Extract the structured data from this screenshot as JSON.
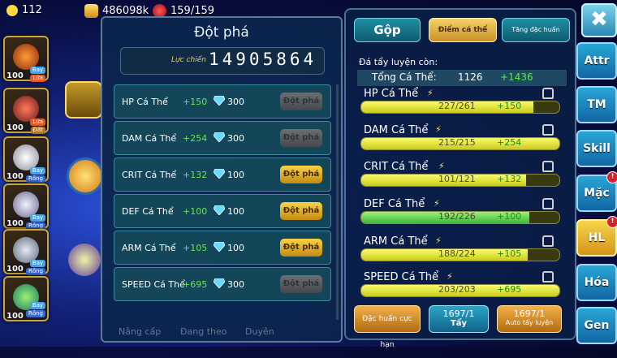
{
  "topbar": {
    "level": "112",
    "gold": "486098k",
    "energy": "159/159"
  },
  "heroes": [
    {
      "level": "100",
      "tags": [
        "Bay",
        "Lửa"
      ]
    },
    {
      "level": "100",
      "tags": [
        "Lửa",
        "Đất"
      ]
    },
    {
      "level": "100",
      "tags": [
        "Bay",
        "Rồng"
      ]
    },
    {
      "level": "100",
      "tags": [
        "Bay",
        "Rồng"
      ]
    },
    {
      "level": "100",
      "tags": [
        "Bay",
        "Rồng"
      ]
    },
    {
      "level": "100",
      "tags": [
        "Bay",
        "Rồng"
      ]
    }
  ],
  "breakthrough": {
    "title": "Đột phá",
    "power_label": "Lực chiến",
    "power_value": "14905864",
    "rows": [
      {
        "name": "HP Cá Thể",
        "bonus": "+150",
        "cost": "300",
        "button": "Đột phá",
        "enabled": false
      },
      {
        "name": "DAM Cá Thể",
        "bonus": "+254",
        "cost": "300",
        "button": "Đột phá",
        "enabled": false
      },
      {
        "name": "CRIT Cá Thể",
        "bonus": "+132",
        "cost": "100",
        "button": "Đột phá",
        "enabled": true
      },
      {
        "name": "DEF Cá Thể",
        "bonus": "+100",
        "cost": "100",
        "button": "Đột phá",
        "enabled": true
      },
      {
        "name": "ARM Cá Thể",
        "bonus": "+105",
        "cost": "100",
        "button": "Đột phá",
        "enabled": true
      },
      {
        "name": "SPEED Cá Thể",
        "bonus": "+695",
        "cost": "300",
        "button": "Đột phá",
        "enabled": false
      }
    ],
    "bottom_nav": [
      "Nâng cấp",
      "Đang theo",
      "Duyên"
    ]
  },
  "training": {
    "tabs": {
      "merge": "Gộp",
      "points": "Điểm cá thể",
      "special": "Tăng đặc huấn"
    },
    "subtitle": "Đá tẩy luyện còn:",
    "total_label": "Tổng Cá Thể:",
    "total_value": "1126",
    "total_bonus": "+1436",
    "stats": [
      {
        "name": "HP Cá Thể",
        "value": "227/261",
        "bonus": "+150",
        "fill": 0.87,
        "color": "yellow"
      },
      {
        "name": "DAM Cá Thể",
        "value": "215/215",
        "bonus": "+254",
        "fill": 1.0,
        "color": "yellow"
      },
      {
        "name": "CRIT Cá Thể",
        "value": "101/121",
        "bonus": "+132",
        "fill": 0.83,
        "color": "yellow"
      },
      {
        "name": "DEF Cá Thể",
        "value": "192/226",
        "bonus": "+100",
        "fill": 0.85,
        "color": "green"
      },
      {
        "name": "ARM Cá Thể",
        "value": "188/224",
        "bonus": "+105",
        "fill": 0.84,
        "color": "yellow"
      },
      {
        "name": "SPEED Cá Thể",
        "value": "203/203",
        "bonus": "+695",
        "fill": 1.0,
        "color": "yellow"
      }
    ],
    "buttons": {
      "special_training": "Đặc huấn cực hạn",
      "wash_count": "1697/1",
      "wash_label": "Tẩy",
      "auto_count": "1697/1",
      "auto_label": "Auto tẩy luyện"
    }
  },
  "side_tabs": [
    {
      "label": "Attr",
      "badge": false
    },
    {
      "label": "TM",
      "badge": false
    },
    {
      "label": "Skill",
      "badge": false
    },
    {
      "label": "Mặc",
      "badge": true
    },
    {
      "label": "HL",
      "badge": true,
      "active": true
    },
    {
      "label": "Hóa",
      "badge": false
    },
    {
      "label": "Gen",
      "badge": false
    }
  ],
  "badge_text": "!",
  "close_label": "✖"
}
